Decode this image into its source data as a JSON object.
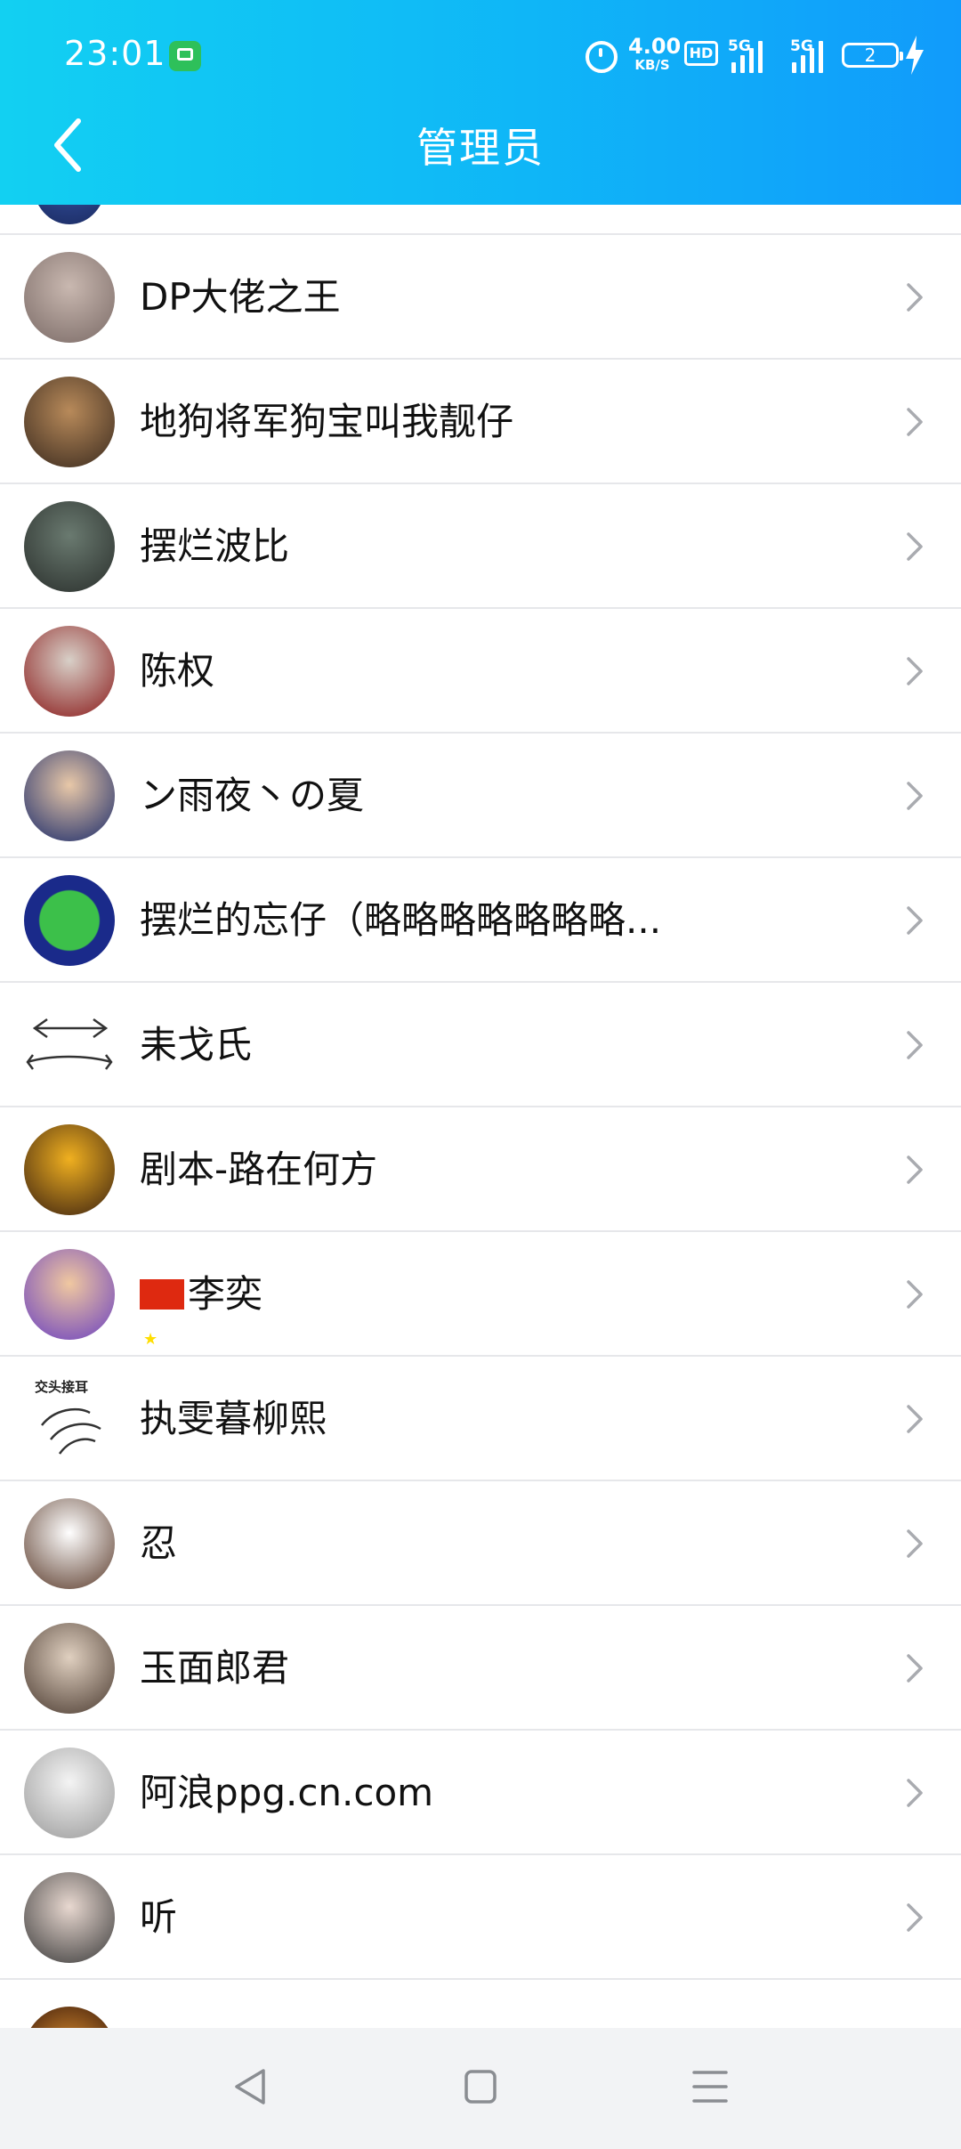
{
  "status_bar": {
    "time": "23:01",
    "net_speed_value": "4.00",
    "net_speed_unit": "KB/S",
    "hd_label": "HD",
    "sim1_label": "5G",
    "sim2_label": "5G",
    "battery_level": "2"
  },
  "header": {
    "title": "管理员",
    "accent_color": "#12c0f5"
  },
  "members": [
    {
      "name": "DP大佬之王",
      "avatar_colors": [
        "#c9b8b0",
        "#7a6a66"
      ]
    },
    {
      "name": "地狗将军狗宝叫我靓仔",
      "avatar_colors": [
        "#b88a5a",
        "#3a2a1e"
      ]
    },
    {
      "name": "摆烂波比",
      "avatar_colors": [
        "#6a7a70",
        "#2a2f2c"
      ]
    },
    {
      "name": "陈权",
      "avatar_colors": [
        "#d8d0c8",
        "#8a1a1a"
      ]
    },
    {
      "name": "ン雨夜丶の夏",
      "avatar_colors": [
        "#e8c8a8",
        "#1a2a6a"
      ]
    },
    {
      "name": "摆烂的忘仔（略略略略略略略...",
      "avatar_colors": [
        "#3cc04a",
        "#1a2a8a"
      ]
    },
    {
      "name": "耒戈氏",
      "avatar_colors": [
        "#ffffff",
        "#333333"
      ]
    },
    {
      "name": "剧本-路在何方",
      "avatar_colors": [
        "#f0b020",
        "#3a2010"
      ]
    },
    {
      "name": "李奕",
      "avatar_colors": [
        "#f0c8a0",
        "#6a40c0"
      ]
    },
    {
      "name": "执雯暮柳熙",
      "avatar_colors": [
        "#ffffff",
        "#444444"
      ]
    },
    {
      "name": "忍",
      "avatar_colors": [
        "#ffffff",
        "#5a3a2a"
      ]
    },
    {
      "name": "玉面郎君",
      "avatar_colors": [
        "#e0d0c0",
        "#4a3a30"
      ]
    },
    {
      "name": "阿浪ppg.cn.com",
      "avatar_colors": [
        "#f4f4f4",
        "#9a9a9a"
      ]
    },
    {
      "name": "听",
      "avatar_colors": [
        "#e8d8d0",
        "#3a3a3a"
      ]
    }
  ],
  "avatar_caption_zhijie": "交头接耳",
  "nav": {
    "back_icon": "triangle-back-icon",
    "home_icon": "square-home-icon",
    "menu_icon": "menu-lines-icon"
  }
}
